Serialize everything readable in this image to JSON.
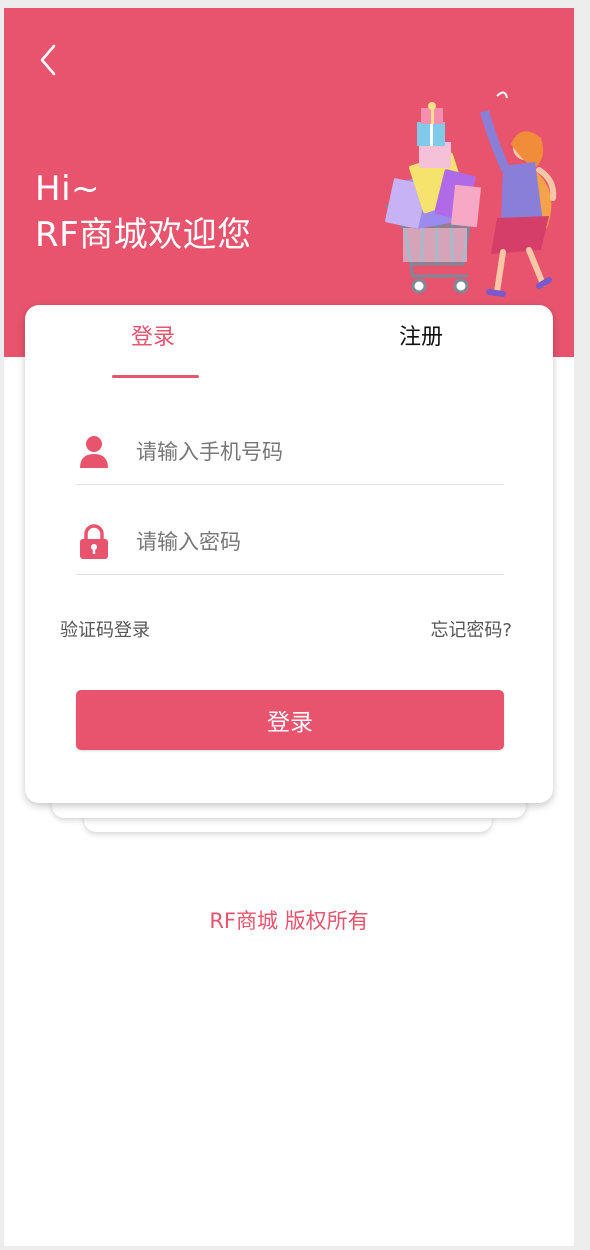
{
  "header": {
    "greeting_line1": "Hi~",
    "greeting_line2": "RF商城欢迎您"
  },
  "tabs": [
    {
      "label": "登录",
      "active": true
    },
    {
      "label": "注册",
      "active": false
    }
  ],
  "form": {
    "phone_placeholder": "请输入手机号码",
    "phone_value": "",
    "password_placeholder": "请输入密码",
    "password_value": "",
    "sms_login_label": "验证码登录",
    "forgot_password_label": "忘记密码?",
    "submit_label": "登录"
  },
  "footer": {
    "copyright": "RF商城 版权所有"
  },
  "icons": {
    "back": "chevron-left-icon",
    "phone": "user-icon",
    "password": "lock-icon",
    "illustration": "shopping-girl-cart-illustration"
  },
  "colors": {
    "accent": "#e8546e",
    "background": "#ffffff"
  }
}
